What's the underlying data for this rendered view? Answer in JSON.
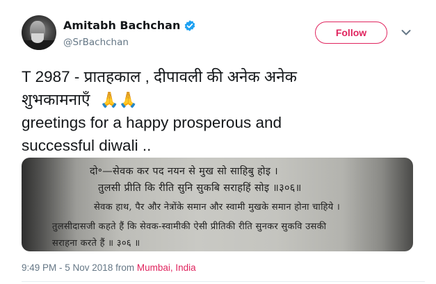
{
  "author": {
    "display_name": "Amitabh Bachchan",
    "handle": "@SrBachchan",
    "verified": true
  },
  "follow_button": {
    "label": "Follow"
  },
  "tweet": {
    "line1": "T 2987 - प्रातहकाल , दीपावली की अनेक अनेक",
    "line2": "शुभकामनाएँ",
    "emojis": "🙏🙏",
    "line3": "greetings for a happy prosperous and",
    "line4": "successful diwali .."
  },
  "media": {
    "lines": [
      "दो॰—सेवक कर पद नयन से मुख सो साहिबु होइ ।",
      "तुलसी प्रीति कि रीति सुनि सुकबि सराहहिं सोइ ॥३०६॥",
      "सेवक हाथ, पैर और नेत्रोंके समान और स्वामी मुखके समान होना चाहिये ।",
      "तुलसीदासजी कहते हैं कि सेवक-स्वामीकी ऐसी प्रीतिकी रीति सुनकर सुकवि उसकी",
      "सराहना करते हैं ॥ ३०६ ॥"
    ]
  },
  "meta": {
    "time": "9:49 PM - 5 Nov 2018",
    "from_label": " from ",
    "location": "Mumbai, India"
  },
  "colors": {
    "accent": "#e0245e",
    "verified": "#1da1f2",
    "secondary_text": "#657786"
  },
  "icons": [
    "verified-badge-icon",
    "chevron-down-icon",
    "folded-hands-emoji"
  ]
}
